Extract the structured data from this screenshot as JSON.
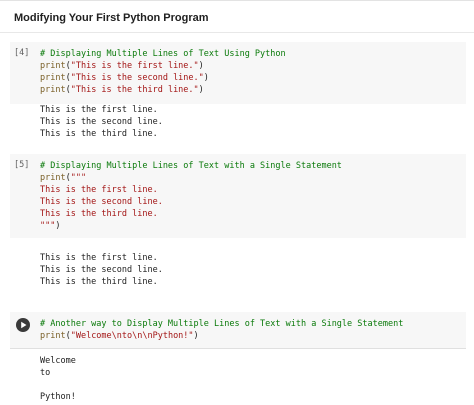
{
  "notebook": {
    "title": "Modifying Your First Python Program"
  },
  "cells": [
    {
      "exec_count": "[4]",
      "code_lines": [
        [
          {
            "t": "# Displaying Multiple Lines of Text Using Python",
            "k": "comment"
          }
        ],
        [
          {
            "t": "print",
            "k": "fn"
          },
          {
            "t": "(",
            "k": "plain"
          },
          {
            "t": "\"This is the first line.\"",
            "k": "str"
          },
          {
            "t": ")",
            "k": "plain"
          }
        ],
        [
          {
            "t": "print",
            "k": "fn"
          },
          {
            "t": "(",
            "k": "plain"
          },
          {
            "t": "\"This is the second line.\"",
            "k": "str"
          },
          {
            "t": ")",
            "k": "plain"
          }
        ],
        [
          {
            "t": "print",
            "k": "fn"
          },
          {
            "t": "(",
            "k": "plain"
          },
          {
            "t": "\"This is the third line.\"",
            "k": "str"
          },
          {
            "t": ")",
            "k": "plain"
          }
        ]
      ],
      "output": "This is the first line.\nThis is the second line.\nThis is the third line."
    },
    {
      "exec_count": "[5]",
      "code_lines": [
        [
          {
            "t": "# Displaying Multiple Lines of Text with a Single Statement",
            "k": "comment"
          }
        ],
        [
          {
            "t": "print",
            "k": "fn"
          },
          {
            "t": "(",
            "k": "plain"
          },
          {
            "t": "\"\"\"",
            "k": "str"
          }
        ],
        [
          {
            "t": "This is the first line.",
            "k": "str"
          }
        ],
        [
          {
            "t": "This is the second line.",
            "k": "str"
          }
        ],
        [
          {
            "t": "This is the third line.",
            "k": "str"
          }
        ],
        [
          {
            "t": "\"\"\"",
            "k": "str"
          },
          {
            "t": ")",
            "k": "plain"
          }
        ]
      ],
      "output": "This is the first line.\nThis is the second line.\nThis is the third line."
    },
    {
      "exec_count": "",
      "code_lines": [
        [
          {
            "t": "# Another way to Display Multiple Lines of Text with a Single Statement",
            "k": "comment"
          }
        ],
        [
          {
            "t": "print",
            "k": "fn"
          },
          {
            "t": "(",
            "k": "plain"
          },
          {
            "t": "\"Welcome\\nto\\n\\nPython!\"",
            "k": "str"
          },
          {
            "t": ")",
            "k": "plain"
          }
        ]
      ],
      "output": "Welcome\nto\n\nPython!"
    }
  ],
  "icons": {
    "run": "play-icon"
  },
  "colors": {
    "comment": "#0a7a0a",
    "function": "#795e26",
    "string": "#a31515",
    "cell_background": "#f7f7f7"
  }
}
